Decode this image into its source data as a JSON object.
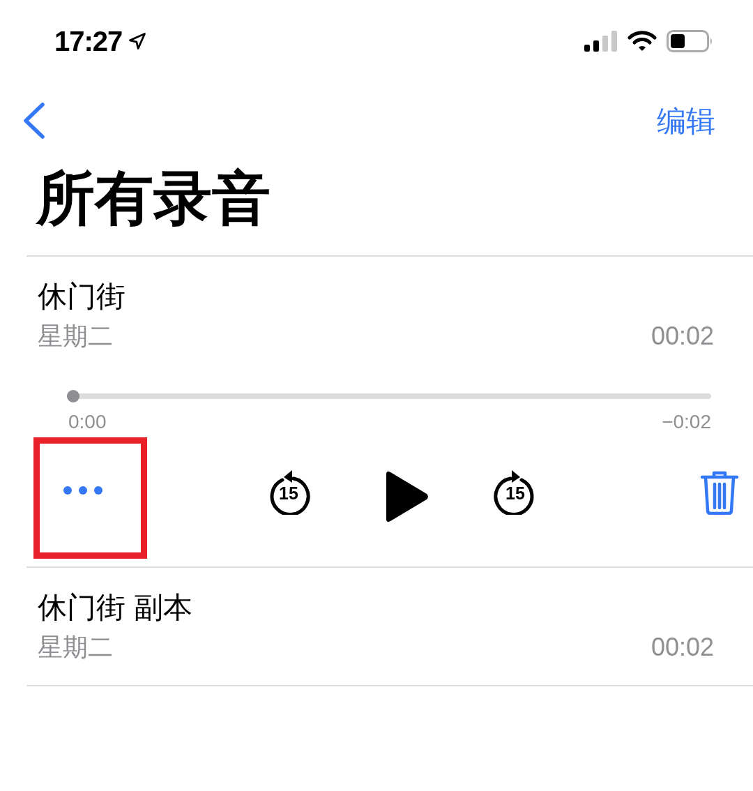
{
  "status_bar": {
    "time": "17:27"
  },
  "nav": {
    "edit": "编辑"
  },
  "title": "所有录音",
  "recordings": [
    {
      "name": "休门街",
      "day": "星期二",
      "duration": "00:02",
      "player": {
        "level": 0,
        "elapsed": "0:00",
        "remaining": "−0:02",
        "skip_back": "15",
        "skip_forward": "15",
        "more_highlighted": true
      }
    },
    {
      "name": "休门街 副本",
      "day": "星期二",
      "duration": "00:02"
    }
  ]
}
